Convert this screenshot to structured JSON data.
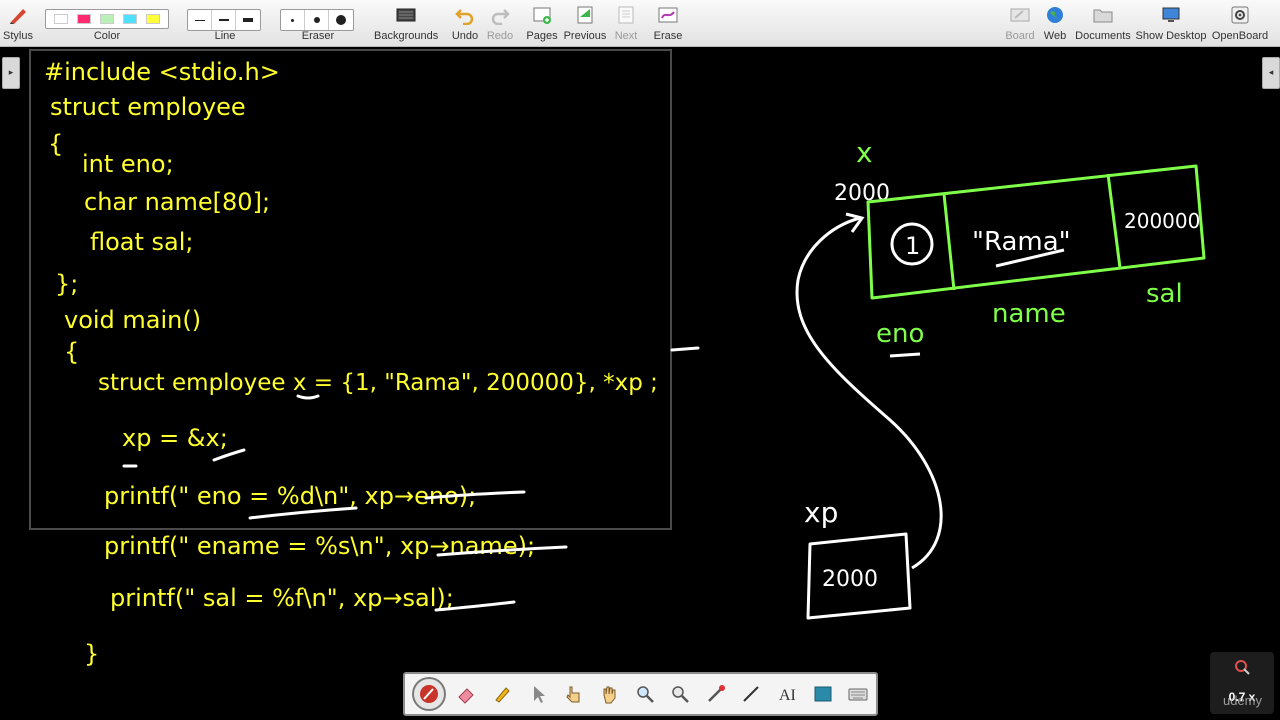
{
  "toolbar": {
    "stylus": "Stylus",
    "color": "Color",
    "line": "Line",
    "eraser": "Eraser",
    "backgrounds": "Backgrounds",
    "undo": "Undo",
    "redo": "Redo",
    "pages": "Pages",
    "previous": "Previous",
    "next": "Next",
    "erase": "Erase",
    "board": "Board",
    "web": "Web",
    "documents": "Documents",
    "show_desktop": "Show Desktop",
    "openboard": "OpenBoard"
  },
  "colors": {
    "swatches": [
      "#ffffff",
      "#ff2b6f",
      "#b8f0b8",
      "#4fe0ff",
      "#ffff3a"
    ],
    "code_ink": "#ffff2e",
    "diagram_green": "#7fff4a",
    "white_ink": "#ffffff"
  },
  "code": {
    "line1": "#include <stdio.h>",
    "line2": "struct employee",
    "line3": "{",
    "line4": "int eno;",
    "line5": "char name[80];",
    "line6": "float sal;",
    "line7": "};",
    "line8": "void main()",
    "line9": "{",
    "line10": "struct employee x = {1, \"Rama\", 200000}, *xp ;",
    "line11": "xp = &x;",
    "line12": "printf(\" eno = %d\\n\", xp→eno);",
    "line13": "printf(\" ename = %s\\n\", xp→name);",
    "line14": "printf(\" sal = %f\\n\", xp→sal);",
    "line15": "}"
  },
  "diagram": {
    "var_x": "x",
    "addr_x": "2000",
    "cell_eno": "1",
    "cell_name": "\"Rama\"",
    "cell_sal": "200000",
    "label_eno": "eno",
    "label_name": "name",
    "label_sal": "sal",
    "var_xp": "xp",
    "xp_value": "2000"
  },
  "zoom": {
    "label": "0.7 x"
  },
  "watermark": "udemy"
}
